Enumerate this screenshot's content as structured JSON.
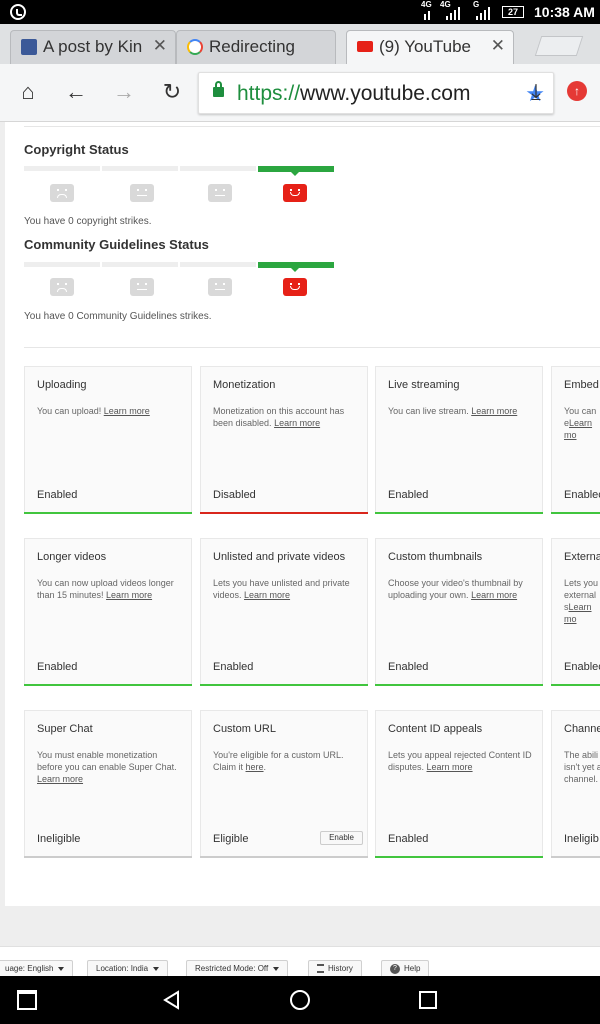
{
  "status_bar": {
    "net1": "4G",
    "net2": "4G",
    "net3": "G",
    "battery": "27",
    "time": "10:38 AM"
  },
  "tabs": [
    {
      "title": "A post by Kin",
      "favicon": "facebook-icon",
      "color": "#3b5998"
    },
    {
      "title": "Redirecting",
      "favicon": "google-icon",
      "color": "#4285f4"
    },
    {
      "title": "(9) YouTube",
      "favicon": "youtube-icon",
      "color": "#e62117"
    }
  ],
  "toolbar": {
    "url_scheme": "https://",
    "url_host": "www.youtube.com"
  },
  "copyright": {
    "title": "Copyright Status",
    "text": "You have 0 copyright strikes."
  },
  "community": {
    "title": "Community Guidelines Status",
    "text": "You have 0 Community Guidelines strikes."
  },
  "features": [
    {
      "name": "Uploading",
      "desc": "You can upload! ",
      "link": "Learn more",
      "status": "Enabled",
      "bar": "green"
    },
    {
      "name": "Monetization",
      "desc": "Monetization on this account has been disabled. ",
      "link": "Learn more",
      "status": "Disabled",
      "bar": "red"
    },
    {
      "name": "Live streaming",
      "desc": "You can live stream. ",
      "link": "Learn more",
      "status": "Enabled",
      "bar": "green"
    },
    {
      "name": "Embed",
      "desc": "You can e",
      "link": "Learn mo",
      "status": "Enablec",
      "bar": "green"
    },
    {
      "name": "Longer videos",
      "desc": "You can now upload videos longer than 15 minutes! ",
      "link": "Learn more",
      "status": "Enabled",
      "bar": "green"
    },
    {
      "name": "Unlisted and private videos",
      "desc": "Lets you have unlisted and private videos. ",
      "link": "Learn more",
      "status": "Enabled",
      "bar": "green"
    },
    {
      "name": "Custom thumbnails",
      "desc": "Choose your video's thumbnail by uploading your own. ",
      "link": "Learn more",
      "status": "Enabled",
      "bar": "green"
    },
    {
      "name": "Externa",
      "desc": "Lets you external s",
      "link": "Learn mo",
      "status": "Enablec",
      "bar": "green"
    },
    {
      "name": "Super Chat",
      "desc": "You must enable monetization before you can enable Super Chat. ",
      "link": "Learn more",
      "status": "Ineligible",
      "bar": "gray"
    },
    {
      "name": "Custom URL",
      "desc": "You're eligible for a custom URL. Claim it ",
      "link": "here",
      "status": "Eligible",
      "bar": "gray",
      "button": "Enable"
    },
    {
      "name": "Content ID appeals",
      "desc": "Lets you appeal rejected Content ID disputes. ",
      "link": "Learn more",
      "status": "Enabled",
      "bar": "green"
    },
    {
      "name": "Channe",
      "desc": "The abili isn't yet a channel.",
      "link": "",
      "status": "Ineligib",
      "bar": "gray"
    }
  ],
  "footer": {
    "language": "uage: English",
    "location": "Location: India",
    "restricted": "Restricted Mode: Off",
    "history": "History",
    "help": "Help"
  }
}
